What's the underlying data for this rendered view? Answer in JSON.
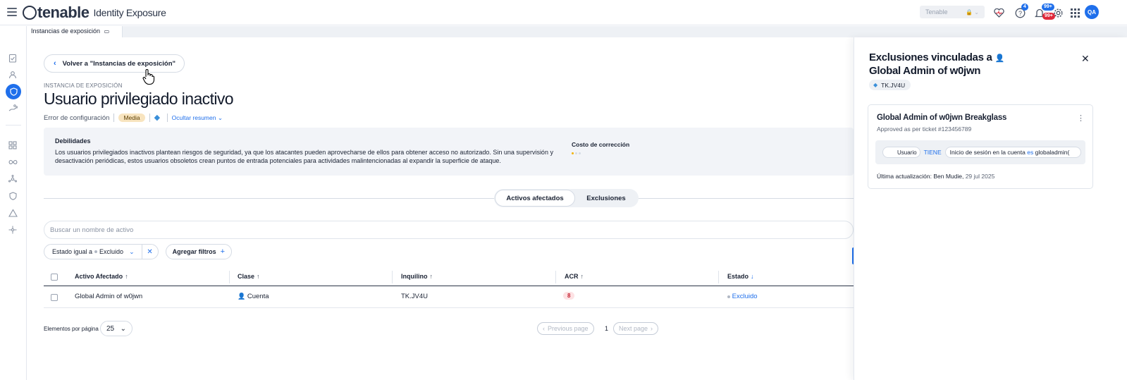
{
  "app": {
    "logo_word": "tenable",
    "product": "Identity Exposure",
    "tenant_select": "Tenable",
    "avatar": "QA",
    "help_badge": "4",
    "notif_badge_blue": "99+",
    "notif_badge_red": "99+",
    "icons": [
      "menu-icon",
      "heart-pulse-icon",
      "help-icon",
      "bell-icon",
      "gear-icon",
      "apps-grid-icon"
    ]
  },
  "tabs": [
    {
      "label": "Instancias de exposición"
    }
  ],
  "main": {
    "back_label": "Volver a \"Instancias de exposición\"",
    "eyebrow": "INSTANCIA DE EXPOSICIÓN",
    "title": "Usuario privilegiado inactivo",
    "category": "Error de configuración",
    "severity": "Media",
    "toggle_summary": "Ocultar resumen",
    "weaknesses_title": "Debilidades",
    "weaknesses_text": "Los usuarios privilegiados inactivos plantean riesgos de seguridad, ya que los atacantes pueden aprovecharse de ellos para obtener acceso no autorizado. Sin una supervisión y desactivación periódicas, estos usuarios obsoletos crean puntos de entrada potenciales para actividades malintencionadas al expandir la superficie de ataque.",
    "remediation_cost_label": "Costo de corrección",
    "remediation_cost_level": 1,
    "segment": {
      "tab_assets": "Activos afectados",
      "tab_exclusions": "Exclusiones"
    },
    "search_placeholder": "Buscar un nombre de activo",
    "filter": {
      "label": "Estado igual a",
      "value": "Excluido"
    },
    "add_filters": "Agregar filtros",
    "table": {
      "columns": [
        "Activo Afectado",
        "Clase",
        "Inquilino",
        "ACR",
        "Estado"
      ],
      "rows": [
        {
          "asset": "Global Admin of w0jwn",
          "class": "Cuenta",
          "tenant": "TK.JV4U",
          "acr": "8",
          "status": "Excluido"
        }
      ]
    },
    "pagination": {
      "per_page_label": "Elementos por página",
      "per_page": "25",
      "prev": "Previous page",
      "page": "1",
      "next": "Next page"
    }
  },
  "panel": {
    "title_line1": "Exclusiones vinculadas a",
    "title_line2": "Global Admin of w0jwn",
    "tenant": "TK.JV4U",
    "card": {
      "title": "Global Admin of w0jwn Breakglass",
      "subtitle": "Approved as per ticket #123456789",
      "rule_subject": "Usuario",
      "rule_keyword": "TIENE",
      "rule_value_prefix": "Inicio de sesión en la cuenta",
      "rule_operator": "es",
      "rule_value": "globaladmin(",
      "updated_prefix": "Última actualización:",
      "updated_by": "Ben Mudie,",
      "updated_date": "29 jul 2025"
    }
  }
}
